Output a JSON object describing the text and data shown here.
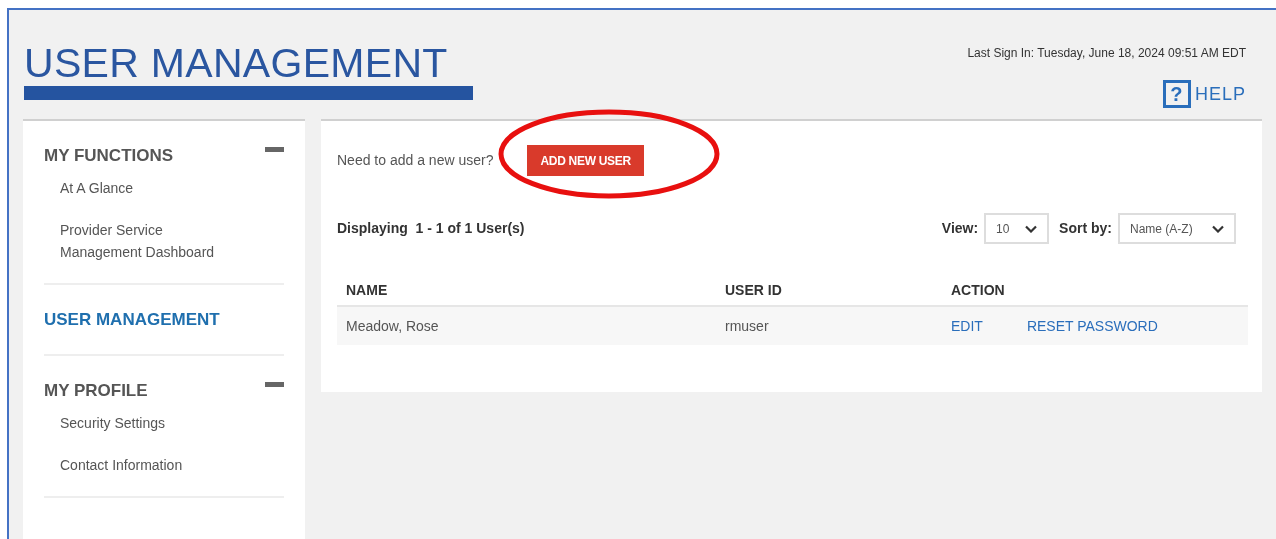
{
  "header": {
    "title": "USER MANAGEMENT",
    "last_sign_in": "Last Sign In: Tuesday, June 18, 2024 09:51 AM EDT",
    "help": "HELP",
    "help_icon": "?"
  },
  "sidebar": {
    "sections": [
      {
        "title": "MY FUNCTIONS",
        "expanded": true,
        "selected": false,
        "items": [
          "At A Glance",
          "Provider Service Management Dashboard"
        ]
      },
      {
        "title": "USER MANAGEMENT",
        "selected": true
      },
      {
        "title": "MY PROFILE",
        "expanded": true,
        "selected": false,
        "items": [
          "Security Settings",
          "Contact Information"
        ]
      }
    ]
  },
  "main": {
    "prompt": "Need to add a new user?",
    "add_button": "ADD NEW USER",
    "annotation": {
      "kind": "ellipse",
      "color": "#e8100f"
    },
    "displaying": "Displaying  1 - 1 of 1 User(s)",
    "view": {
      "label": "View:",
      "value": "10"
    },
    "sort": {
      "label": "Sort by:",
      "value": "Name (A-Z)"
    },
    "table": {
      "columns": [
        "NAME",
        "USER ID",
        "ACTION"
      ],
      "rows": [
        {
          "name": "Meadow, Rose",
          "user_id": "rmuser",
          "actions": [
            "EDIT",
            "RESET PASSWORD"
          ]
        }
      ]
    }
  }
}
